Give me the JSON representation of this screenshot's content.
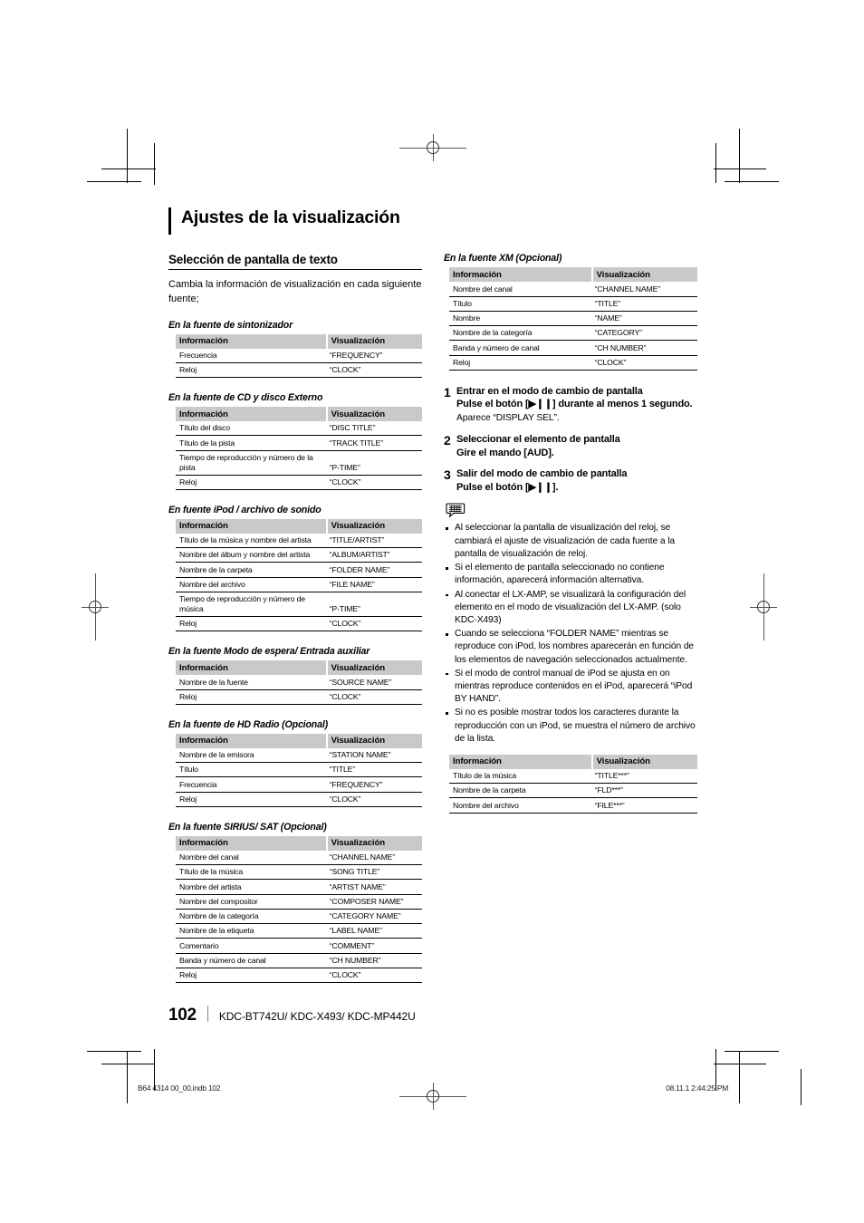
{
  "chapter": {
    "title": "Ajustes de la visualización"
  },
  "section": {
    "heading": "Selección de pantalla de texto",
    "intro": "Cambia la información de visualización en cada siguiente fuente;"
  },
  "table_headers": {
    "info": "Información",
    "display": "Visualización"
  },
  "tables": [
    {
      "id": "tuner",
      "caption": "En la fuente de sintonizador",
      "rows": [
        [
          "Frecuencia",
          "“FREQUENCY”"
        ],
        [
          "Reloj",
          "“CLOCK”"
        ]
      ]
    },
    {
      "id": "cd-external-disc",
      "caption": "En la fuente de CD y disco Externo",
      "rows": [
        [
          "Título del disco",
          "“DISC TITLE”"
        ],
        [
          "Título de la pista",
          "“TRACK TITLE”"
        ],
        [
          "Tiempo de reproducción y número de la pista",
          "“P-TIME”"
        ],
        [
          "Reloj",
          "“CLOCK”"
        ]
      ]
    },
    {
      "id": "ipod-audio-file",
      "caption": "En fuente iPod / archivo de sonido",
      "rows": [
        [
          "Título de la música y nombre del artista",
          "“TITLE/ARTIST”"
        ],
        [
          "Nombre del álbum y nombre del artista",
          "“ALBUM/ARTIST”"
        ],
        [
          "Nombre de la carpeta",
          "“FOLDER NAME”"
        ],
        [
          "Nombre del archivo",
          "“FILE NAME”"
        ],
        [
          "Tiempo de reproducción y número de música",
          "“P-TIME”"
        ],
        [
          "Reloj",
          "“CLOCK”"
        ]
      ]
    },
    {
      "id": "standby-aux",
      "caption": "En la fuente Modo de espera/ Entrada auxiliar",
      "rows": [
        [
          "Nombre de la fuente",
          "“SOURCE NAME”"
        ],
        [
          "Reloj",
          "“CLOCK”"
        ]
      ]
    },
    {
      "id": "hd-radio",
      "caption": "En la fuente de HD Radio (Opcional)",
      "rows": [
        [
          "Nombre de la emisora",
          "“STATION NAME”"
        ],
        [
          "Título",
          "“TITLE”"
        ],
        [
          "Frecuencia",
          "“FREQUENCY”"
        ],
        [
          "Reloj",
          "“CLOCK”"
        ]
      ]
    },
    {
      "id": "sirius-sat",
      "caption": "En la fuente SIRIUS/ SAT (Opcional)",
      "rows": [
        [
          "Nombre del canal",
          "“CHANNEL NAME”"
        ],
        [
          "Título de la música",
          "“SONG TITLE”"
        ],
        [
          "Nombre del artista",
          "“ARTIST NAME”"
        ],
        [
          "Nombre del compositor",
          "“COMPOSER NAME”"
        ],
        [
          "Nombre de la categoría",
          "“CATEGORY NAME”"
        ],
        [
          "Nombre de la etiqueta",
          "“LABEL NAME”"
        ],
        [
          "Comentario",
          "“COMMENT”"
        ],
        [
          "Banda y número de canal",
          "“CH NUMBER”"
        ],
        [
          "Reloj",
          "“CLOCK”"
        ]
      ]
    },
    {
      "id": "xm",
      "caption": "En la fuente XM (Opcional)",
      "rows": [
        [
          "Nombre del canal",
          "“CHANNEL NAME”"
        ],
        [
          "Título",
          "“TITLE”"
        ],
        [
          "Nombre",
          "“NAME”"
        ],
        [
          "Nombre de la categoría",
          "“CATEGORY”"
        ],
        [
          "Banda y número de canal",
          "“CH NUMBER”"
        ],
        [
          "Reloj",
          "“CLOCK”"
        ]
      ]
    },
    {
      "id": "truncated-display",
      "caption": "",
      "rows": [
        [
          "Título de la música",
          "“TITLE***”"
        ],
        [
          "Nombre de la carpeta",
          "“FLD***”"
        ],
        [
          "Nombre del archivo",
          "“FILE***”"
        ]
      ]
    }
  ],
  "steps": [
    {
      "num": "1",
      "title": "Entrar en el modo de cambio de pantalla",
      "sub": "Pulse el botón [▶❙❙] durante al menos 1 segundo.",
      "note": "Aparece “DISPLAY SEL”."
    },
    {
      "num": "2",
      "title": "Seleccionar el elemento de pantalla",
      "sub": "Gire el mando [AUD].",
      "note": ""
    },
    {
      "num": "3",
      "title": "Salir del modo de cambio de pantalla",
      "sub": "Pulse el botón [▶❙❙].",
      "note": ""
    }
  ],
  "notes_icon": "speech-bubble-note-icon",
  "notes": [
    "Al seleccionar la pantalla de visualización del reloj, se cambiará el ajuste de visualización de cada fuente a la pantalla de visualización de reloj.",
    "Si el elemento de pantalla seleccionado no contiene información, aparecerá información alternativa.",
    "Al conectar el LX-AMP, se visualizará la configuración del elemento en el modo de visualización del LX-AMP. (solo KDC-X493)",
    "Cuando se selecciona “FOLDER NAME” mientras se reproduce con iPod, los nombres aparecerán en función de los elementos de navegación seleccionados actualmente.",
    "Si el modo de control manual de iPod se ajusta en on mientras reproduce contenidos en el iPod, aparecerá “iPod BY HAND”.",
    "Si no es posible mostrar todos los caracteres durante la reproducción con un iPod, se muestra el número de archivo de la lista."
  ],
  "footer": {
    "page_number": "102",
    "models": "KDC-BT742U/ KDC-X493/ KDC-MP442U"
  },
  "slug": {
    "left": "B64 4314 00_00.indb   102",
    "right": "08.11.1   2:44:25 PM"
  }
}
